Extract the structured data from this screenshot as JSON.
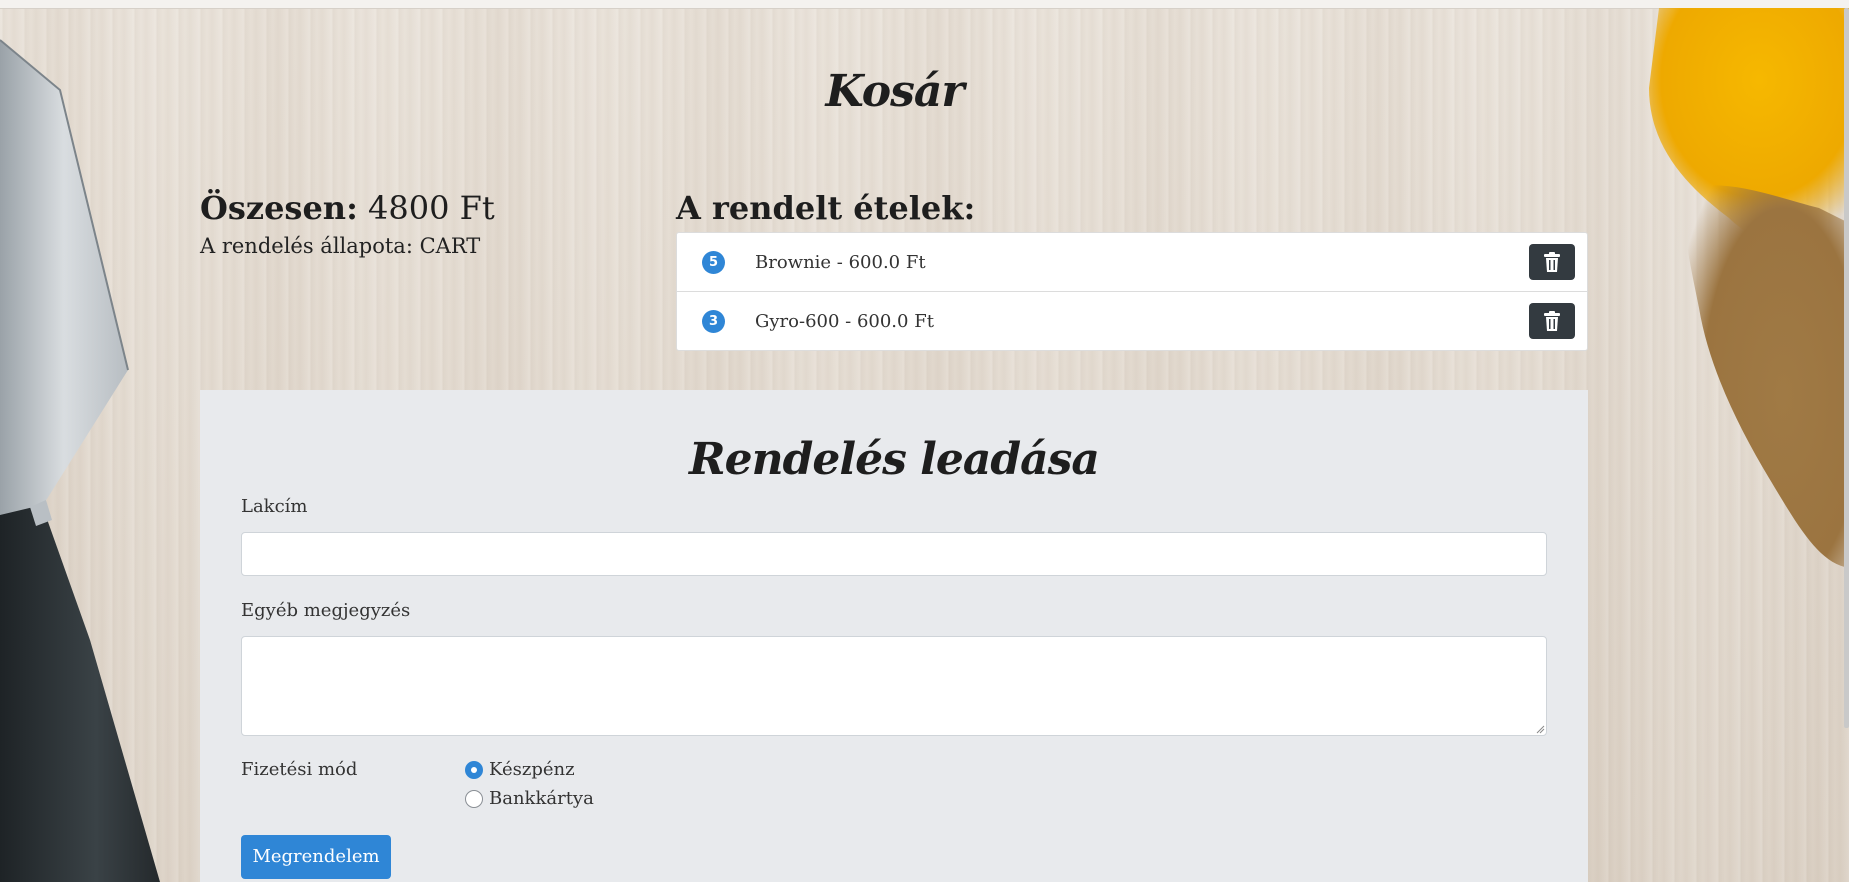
{
  "page": {
    "title": "Kosár"
  },
  "summary": {
    "total_label": "Öszesen:",
    "total_value": "4800 Ft",
    "status_label": "A rendelés állapota:",
    "status_value": "CART"
  },
  "ordered": {
    "title": "A rendelt ételek:",
    "items": [
      {
        "qty": "5",
        "text": "Brownie - 600.0 Ft",
        "delete_icon": "trash-icon"
      },
      {
        "qty": "3",
        "text": "Gyro-600 - 600.0 Ft",
        "delete_icon": "trash-icon"
      }
    ]
  },
  "order_form": {
    "title": "Rendelés leadása",
    "address_label": "Lakcím",
    "address_value": "",
    "note_label": "Egyéb megjegyzés",
    "note_value": "",
    "payment_label": "Fizetési mód",
    "payment_options": [
      {
        "label": "Készpénz",
        "checked": true
      },
      {
        "label": "Bankkártya",
        "checked": false
      }
    ],
    "submit_label": "Megrendelem"
  },
  "colors": {
    "accent": "#2f86d6",
    "dark_button": "#333a40",
    "panel_bg": "#e8eaed"
  }
}
